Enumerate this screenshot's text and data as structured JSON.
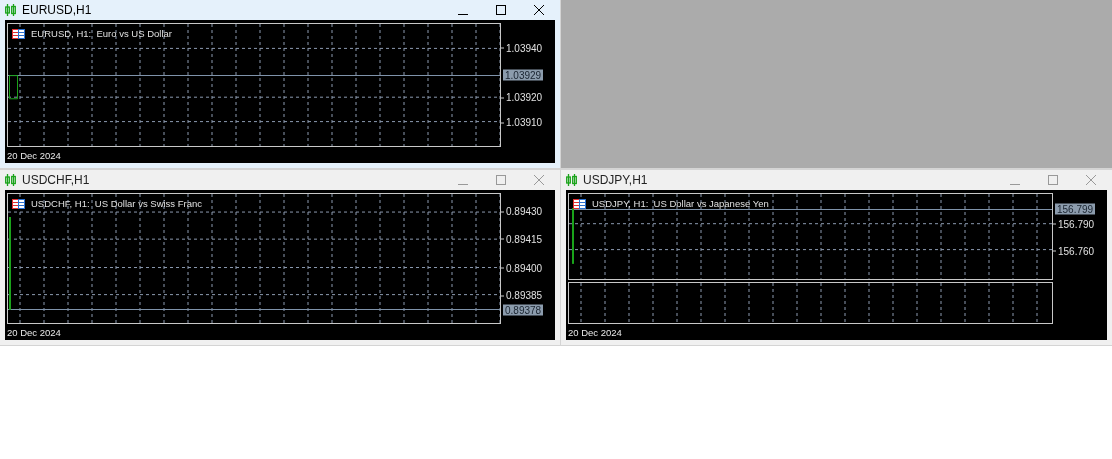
{
  "workspace": {
    "windows": [
      {
        "title": "EURUSD,H1",
        "active": true,
        "legend": "EURUSD, H1:  Euro vs US Dollar",
        "price_labels": [
          "1.03940",
          "1.03920",
          "1.03910"
        ],
        "current_price": "1.03929",
        "indicator_pane": false,
        "date": "20 Dec 2024"
      },
      {
        "title": "USDCHF,H1",
        "active": false,
        "legend": "USDCHF, H1:  US Dollar vs Swiss Franc",
        "price_labels": [
          "0.89430",
          "0.89415",
          "0.89400",
          "0.89385"
        ],
        "current_price": "0.89378",
        "indicator_pane": false,
        "date": "20 Dec 2024"
      },
      {
        "title": "USDJPY,H1",
        "active": false,
        "legend": "USDJPY, H1:  US Dollar vs Japanese Yen",
        "price_labels": [
          "156.790",
          "156.760"
        ],
        "current_price": "156.799",
        "indicator_pane": true,
        "date": "20 Dec 2024"
      }
    ]
  }
}
